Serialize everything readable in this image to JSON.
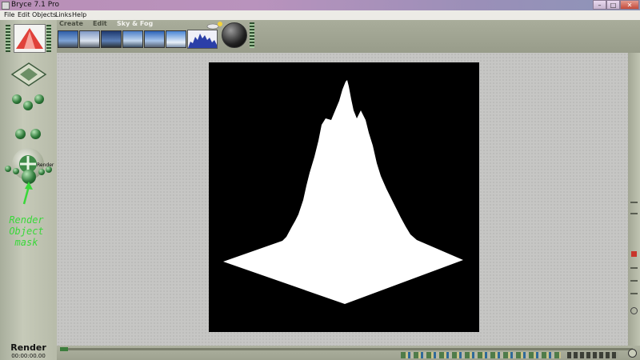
{
  "window": {
    "title": "Bryce 7.1  Pro",
    "controls": {
      "minimize": "–",
      "maximize": "□",
      "close": "✕"
    }
  },
  "menu": [
    "File",
    "Edit",
    "Objects",
    "Links",
    "Help"
  ],
  "palette_tabs": {
    "create": "Create",
    "edit": "Edit",
    "sky_fog": "Sky & Fog"
  },
  "left_panel": {
    "render_hint": "Render",
    "render_title": "Render",
    "render_time": "00:00:00.00"
  },
  "annotation": {
    "line1": "Render",
    "line2": "Object",
    "line3": "mask"
  },
  "colors": {
    "annotation": "#39d839",
    "canvas_bg": "#c6c6c4",
    "render_bg": "#000000",
    "terrain": "#ffffff"
  },
  "icons": [
    "nano-preview-icon",
    "camera-cross-icon",
    "trackball-icon",
    "render-ball-icon",
    "sun-dial-icon",
    "timeline-icon"
  ]
}
